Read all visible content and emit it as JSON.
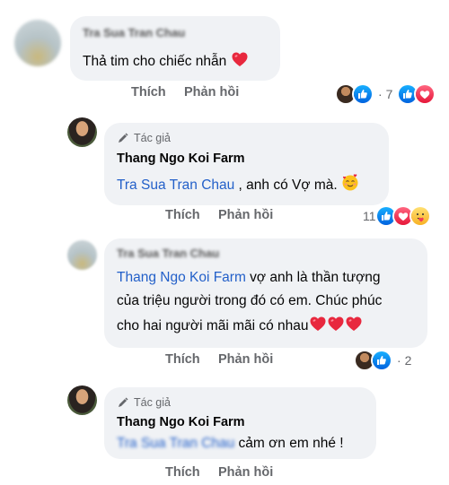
{
  "comments": [
    {
      "author": "Tra Sua Tran Chau",
      "text": "Thả tim cho chiếc nhẫn",
      "like_label": "Thích",
      "reply_label": "Phản hồi",
      "reaction_count": "7"
    },
    {
      "badge": "Tác giả",
      "author": "Thang Ngo Koi Farm",
      "mention": "Tra Sua Tran Chau",
      "text": " , anh có Vợ mà.",
      "like_label": "Thích",
      "reply_label": "Phản hồi",
      "reaction_count": "11"
    },
    {
      "author": "Tra Sua Tran Chau",
      "mention": "Thang Ngo Koi Farm",
      "text_line1": " vợ anh là thần tượng",
      "text_line2": "của triệu người trong đó có em. Chúc phúc",
      "text_line3": "cho hai người mãi mãi có nhau",
      "like_label": "Thích",
      "reply_label": "Phản hồi",
      "reaction_count": "2"
    },
    {
      "badge": "Tác giả",
      "author": "Thang Ngo Koi Farm",
      "mention": "Tra Sua Tran Chau",
      "text": " cảm ơn em nhé !",
      "like_label": "Thích",
      "reply_label": "Phản hồi"
    }
  ],
  "icons": {
    "like": "like-icon",
    "love": "love-icon",
    "care": "care-icon",
    "author_badge": "pencil-icon"
  },
  "colors": {
    "like_blue": "#1877f2",
    "love_red": "#f33e58",
    "mention_blue": "#2360c9",
    "bubble": "#f0f2f5"
  }
}
